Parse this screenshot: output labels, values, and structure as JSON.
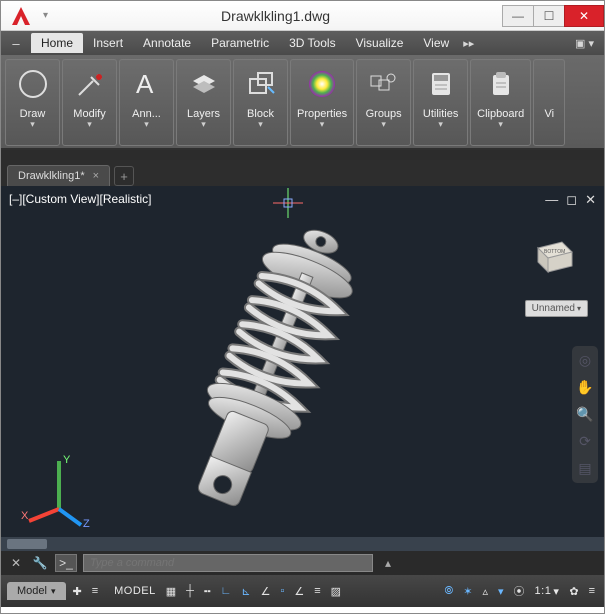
{
  "window": {
    "title": "Drawklkling1.dwg"
  },
  "menubar": {
    "tabs": [
      "Home",
      "Insert",
      "Annotate",
      "Parametric",
      "3D Tools",
      "Visualize",
      "View"
    ]
  },
  "ribbon": {
    "panels": [
      {
        "label": "Draw"
      },
      {
        "label": "Modify"
      },
      {
        "label": "Ann..."
      },
      {
        "label": "Layers"
      },
      {
        "label": "Block"
      },
      {
        "label": "Properties"
      },
      {
        "label": "Groups"
      },
      {
        "label": "Utilities"
      },
      {
        "label": "Clipboard"
      },
      {
        "label": "Vi"
      }
    ]
  },
  "documentTabs": {
    "active": "Drawklkling1*"
  },
  "viewport": {
    "label": "[–][Custom View][Realistic]",
    "viewcube_face": "BOTTOM",
    "unnamed_label": "Unnamed",
    "ucs": {
      "x": "X",
      "y": "Y",
      "z": "Z"
    }
  },
  "commandLine": {
    "placeholder": "Type a command",
    "prompt": ">_"
  },
  "statusBar": {
    "modelTab": "Model",
    "spaceLabel": "MODEL",
    "scale": "1:1"
  }
}
